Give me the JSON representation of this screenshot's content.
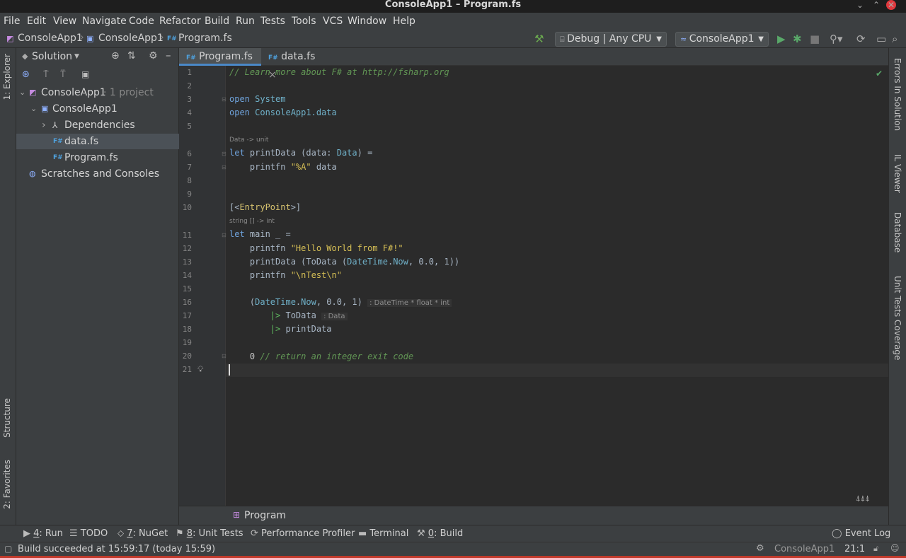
{
  "window": {
    "title": "ConsoleApp1 – Program.fs",
    "controls": [
      "⌄",
      "⌃",
      "✕"
    ]
  },
  "menu": [
    "File",
    "Edit",
    "View",
    "Navigate",
    "Code",
    "Refactor",
    "Build",
    "Run",
    "Tests",
    "Tools",
    "VCS",
    "Window",
    "Help"
  ],
  "breadcrumb": [
    "ConsoleApp1",
    "ConsoleApp1",
    "Program.fs"
  ],
  "run_config": {
    "build_config": "Debug | Any CPU",
    "project": "ConsoleApp1"
  },
  "left_tabs": [
    "1: Explorer",
    "Structure",
    "2: Favorites"
  ],
  "right_tabs": [
    "Errors In Solution",
    "IL Viewer",
    "Database",
    "Unit Tests Coverage"
  ],
  "solution": {
    "header": "Solution",
    "tree": [
      {
        "label": "ConsoleApp1",
        "suffix": "· 1 project",
        "indent": 0,
        "arrow": "⌄"
      },
      {
        "label": "ConsoleApp1",
        "suffix": "",
        "indent": 1,
        "arrow": "⌄"
      },
      {
        "label": "Dependencies",
        "suffix": "",
        "indent": 2,
        "arrow": "›"
      },
      {
        "label": "data.fs",
        "suffix": "",
        "indent": 2,
        "arrow": "",
        "selected": true,
        "badge": "F#"
      },
      {
        "label": "Program.fs",
        "suffix": "",
        "indent": 2,
        "arrow": "",
        "badge": "F#"
      },
      {
        "label": "Scratches and Consoles",
        "suffix": "",
        "indent": 0,
        "arrow": ""
      }
    ]
  },
  "editor": {
    "tabs": [
      {
        "badge": "F#",
        "label": "Program.fs",
        "close": "×",
        "active": true
      },
      {
        "badge": "F#",
        "label": "data.fs",
        "close": "×",
        "active": false
      }
    ],
    "line_numbers": [
      "1",
      "2",
      "3",
      "4",
      "5",
      "6",
      "7",
      "8",
      "9",
      "10",
      "11",
      "12",
      "13",
      "14",
      "15",
      "16",
      "17",
      "18",
      "19",
      "20",
      "21"
    ],
    "hints": {
      "h1": "Data -> unit",
      "h2": "string [] -> int"
    },
    "code": {
      "l1": "// Learn more about F# at http://fsharp.org",
      "l3_kw": "open",
      "l3_rest": " System",
      "l4_kw": "open",
      "l4_rest": " ConsoleApp1.data",
      "l6_kw": "let",
      "l6_a": " printData (data: ",
      "l6_ty": "Data",
      "l6_b": ") =",
      "l7_a": "    printfn ",
      "l7_str": "\"%A\"",
      "l7_b": " data",
      "l10_a": "[<",
      "l10_attr": "EntryPoint",
      "l10_b": ">]",
      "l11_kw": "let",
      "l11_rest": " main _ =",
      "l12_a": "    printfn ",
      "l12_str": "\"Hello World from F#!\"",
      "l13_a": "    printData (ToData (",
      "l13_ty": "DateTime",
      "l13_b": ".",
      "l13_now": "Now",
      "l13_c": ", 0.0, 1))",
      "l14_a": "    printfn ",
      "l14_str": "\"\\nTest\\n\"",
      "l16_a": "    (",
      "l16_ty": "DateTime",
      "l16_b": ".",
      "l16_now": "Now",
      "l16_c": ", 0.0, 1)",
      "l16_hint": ": DateTime * float * int",
      "l17_pipe": "        |>",
      "l17_rest": " ToData",
      "l17_hint": ": Data",
      "l18_pipe": "        |>",
      "l18_rest": " printData",
      "l20_a": "    0 ",
      "l20_cm": "// return an integer exit code"
    },
    "breadcrumb_bottom": "Program"
  },
  "tool_windows": [
    {
      "key": "4",
      "label": ": Run"
    },
    {
      "key": "",
      "label": "TODO"
    },
    {
      "key": "7",
      "label": ": NuGet"
    },
    {
      "key": "8",
      "label": ": Unit Tests"
    },
    {
      "key": "",
      "label": "Performance Profiler"
    },
    {
      "key": "",
      "label": "Terminal"
    },
    {
      "key": "0",
      "label": ": Build"
    }
  ],
  "event_log": "Event Log",
  "status": {
    "message": "Build succeeded at 15:59:17 (today 15:59)",
    "project": "ConsoleApp1",
    "position": "21:1"
  },
  "colors": {
    "accent": "#4a88c7",
    "comment": "#629755",
    "string": "#d6bf55",
    "keyword": "#6fa3dc"
  }
}
